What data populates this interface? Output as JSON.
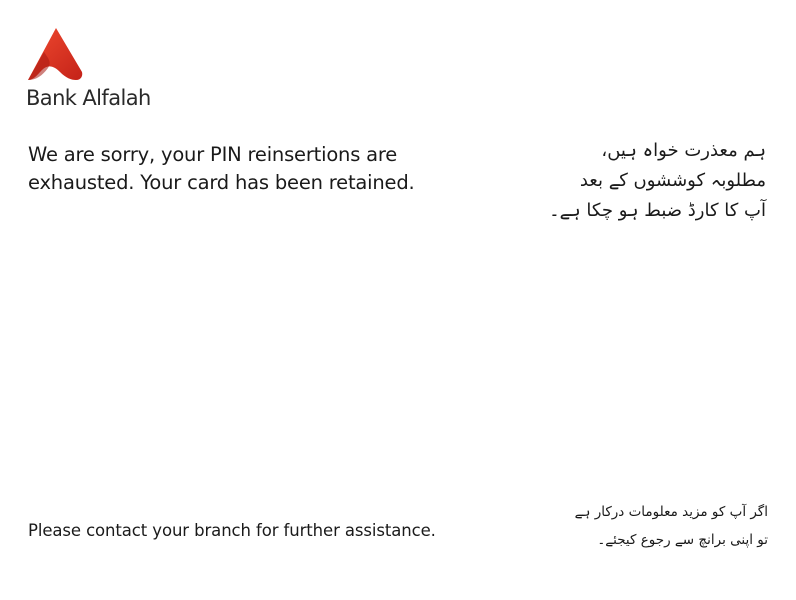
{
  "brand": {
    "name": "Bank Alfalah",
    "accent_color": "#e03a2a",
    "accent_dark": "#b01e16"
  },
  "message": {
    "english": "We are sorry, your PIN reinsertions are exhausted. Your card has been retained.",
    "urdu_lines": [
      "ہم معذرت خواہ ہیں،",
      "مطلوبہ کوششوں کے بعد",
      "آپ کا کارڈ ضبط ہو چکا ہے۔"
    ]
  },
  "footer": {
    "english": "Please contact your branch for further assistance.",
    "urdu_lines": [
      "اگر آپ کو مزید معلومات درکار ہے",
      "تو اپنی برانچ سے رجوع کیجئے۔"
    ]
  }
}
